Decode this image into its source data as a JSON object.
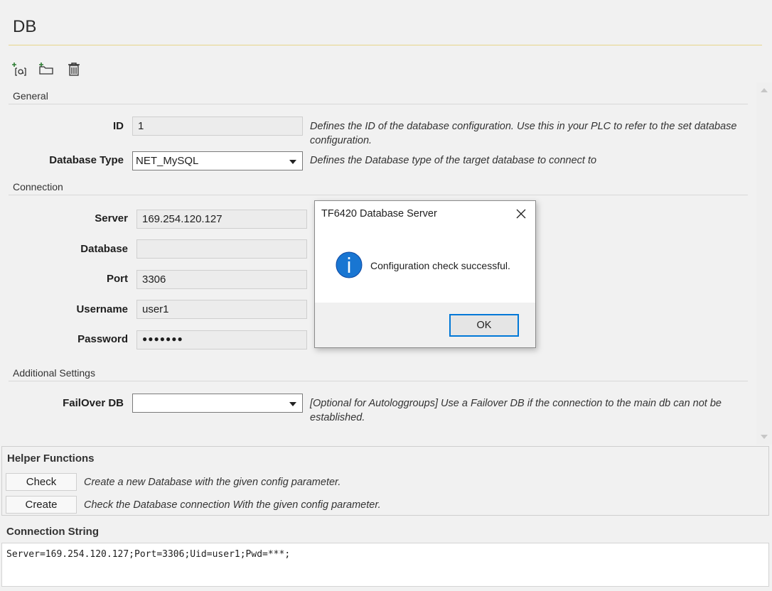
{
  "title": "DB",
  "toolbar": {
    "icons": [
      "add-config-icon",
      "add-folder-icon",
      "delete-icon"
    ],
    "colors": {
      "accent": "#2e7d32"
    }
  },
  "sections": {
    "general": "General",
    "connection": "Connection",
    "additional": "Additional Settings"
  },
  "general": {
    "id_label": "ID",
    "id_value": "1",
    "id_desc": "Defines the ID of the database configuration. Use this in your PLC to refer to the set database configuration.",
    "db_type_label": "Database Type",
    "db_type_value": "NET_MySQL",
    "db_type_desc": "Defines the Database type of the target database to connect to"
  },
  "connection": {
    "server_label": "Server",
    "server_value": "169.254.120.127",
    "database_label": "Database",
    "database_value": "",
    "port_label": "Port",
    "port_value": "3306",
    "username_label": "Username",
    "username_value": "user1",
    "password_label": "Password",
    "password_value": "●●●●●●●"
  },
  "additional": {
    "failover_label": "FailOver DB",
    "failover_value": "",
    "failover_desc": "[Optional for Autologgroups] Use a Failover DB if the connection to the main db can not be established."
  },
  "helper": {
    "title": "Helper Functions",
    "check_label": "Check",
    "check_desc": "Create a new Database with the given config parameter.",
    "create_label": "Create",
    "create_desc": "Check the Database connection With the given config parameter."
  },
  "connection_string": {
    "title": "Connection String",
    "value": "Server=169.254.120.127;Port=3306;Uid=user1;Pwd=***;"
  },
  "dialog": {
    "title": "TF6420 Database Server",
    "message": "Configuration check successful.",
    "ok_label": "OK",
    "icon": "info-icon",
    "icon_color": "#1976d2"
  }
}
